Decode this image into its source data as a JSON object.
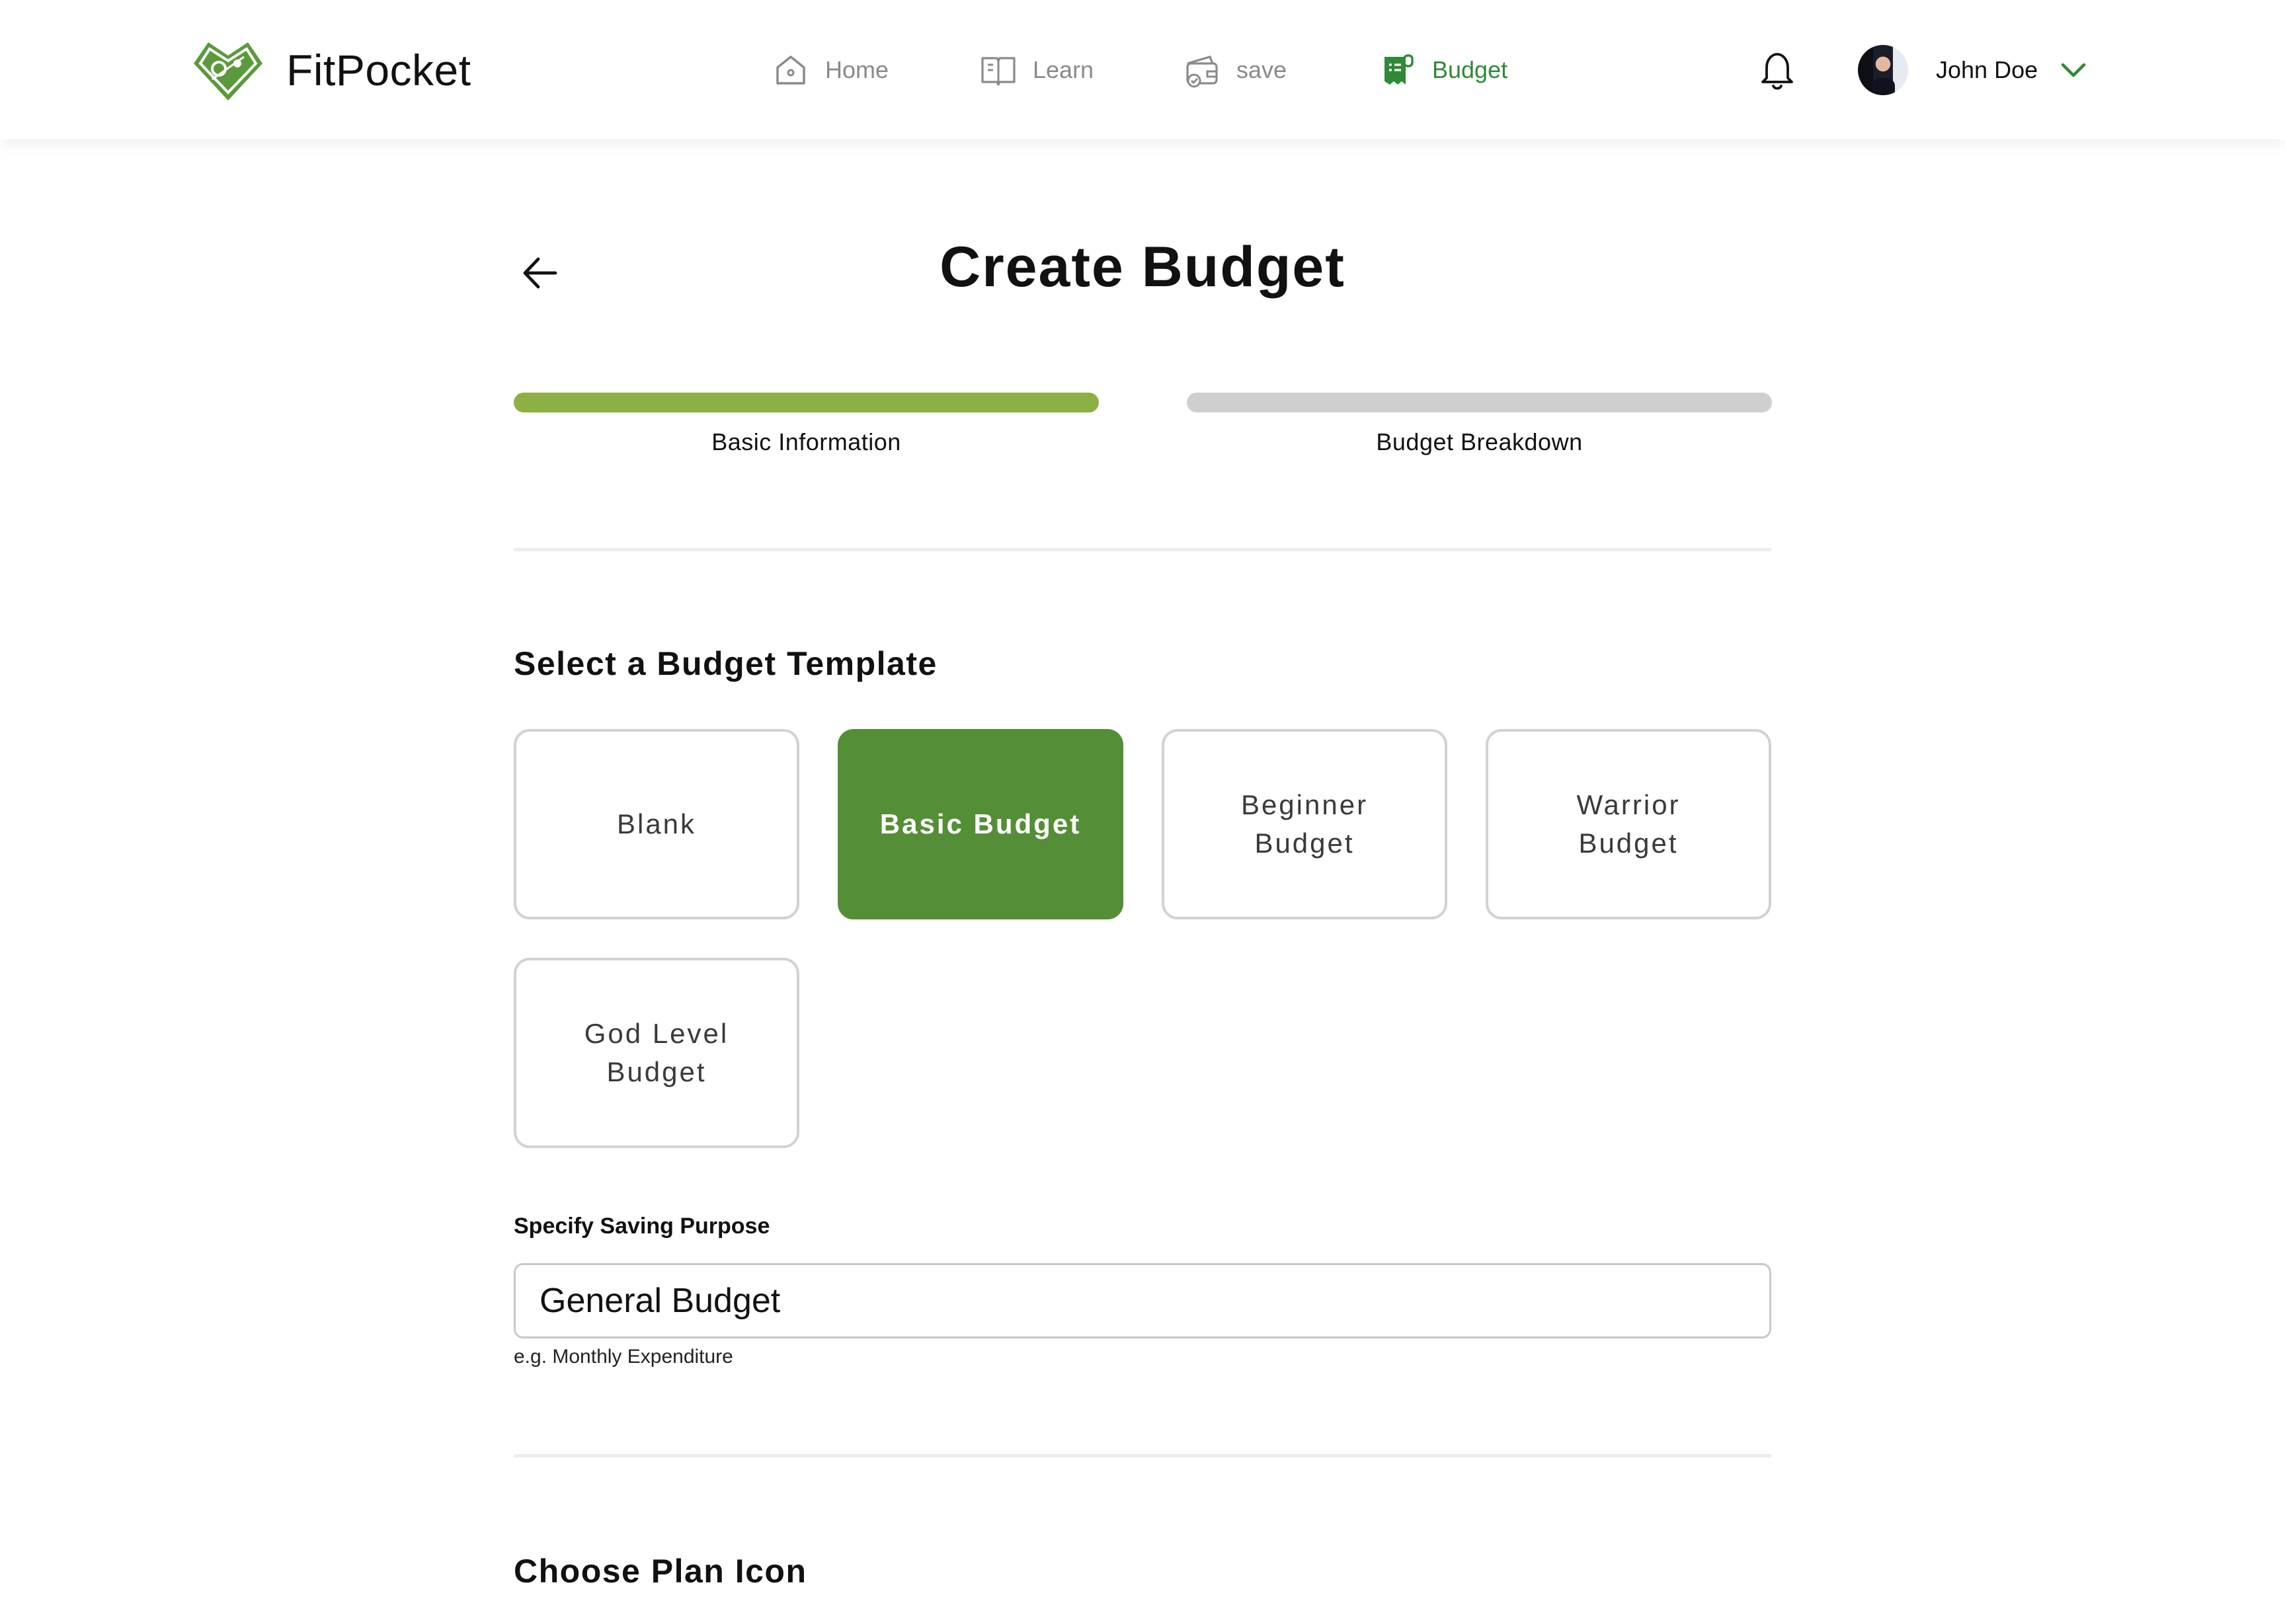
{
  "app": {
    "name": "FitPocket"
  },
  "nav": [
    {
      "label": "Home",
      "icon": "home-icon"
    },
    {
      "label": "Learn",
      "icon": "book-icon"
    },
    {
      "label": "save",
      "icon": "wallet-icon"
    },
    {
      "label": "Budget",
      "icon": "budget-receipt-icon",
      "active": true
    }
  ],
  "user": {
    "name": "John Doe"
  },
  "page": {
    "title": "Create Budget"
  },
  "steps": [
    {
      "label": "Basic Information",
      "completed": true
    },
    {
      "label": "Budget Breakdown",
      "completed": false
    }
  ],
  "template_section": {
    "title": "Select a Budget Template",
    "templates": [
      {
        "label": "Blank",
        "selected": false
      },
      {
        "label": "Basic Budget",
        "selected": true
      },
      {
        "label": "Beginner\nBudget",
        "selected": false
      },
      {
        "label": "Warrior\nBudget",
        "selected": false
      },
      {
        "label": "God Level\nBudget",
        "selected": false
      }
    ]
  },
  "purpose": {
    "label": "Specify Saving Purpose",
    "value": "General Budget",
    "hint": "e.g. Monthly Expenditure"
  },
  "icon_section": {
    "title": "Choose Plan Icon"
  },
  "colors": {
    "accent": "#548e36",
    "progress_done": "#8cb043",
    "progress_todo": "#cfcfcf"
  }
}
